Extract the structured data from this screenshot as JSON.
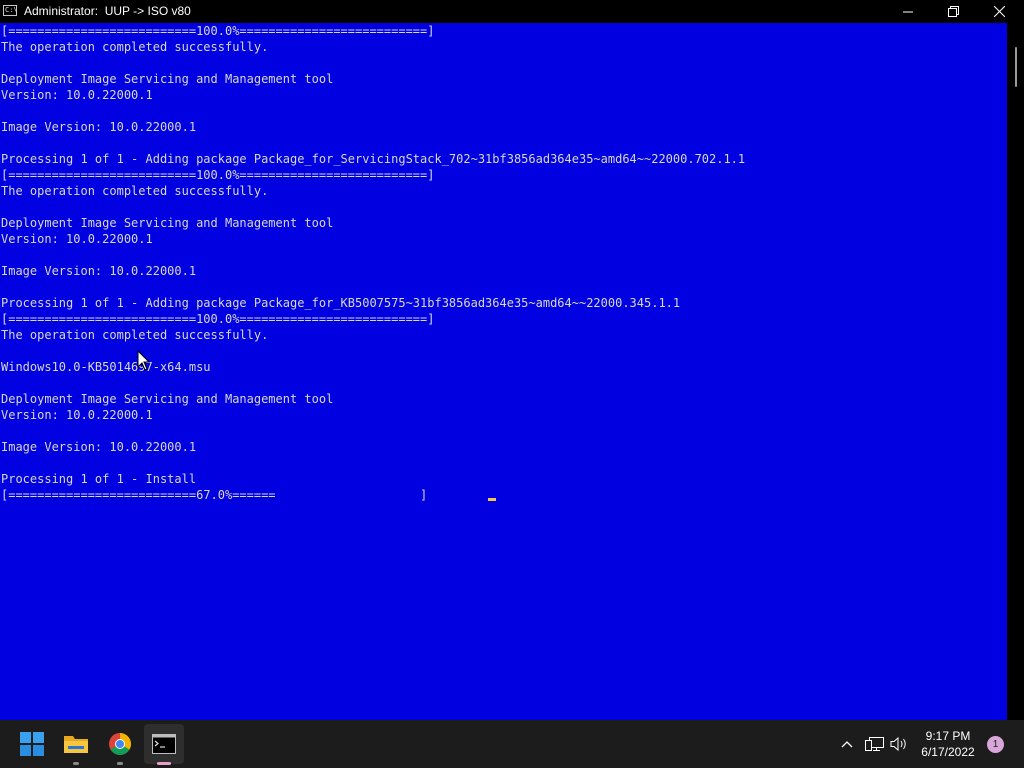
{
  "window": {
    "title": "Administrator:  UUP -> ISO v80",
    "icon_text": "C:\\"
  },
  "console": {
    "lines": [
      "[==========================100.0%==========================]",
      "The operation completed successfully.",
      "",
      "Deployment Image Servicing and Management tool",
      "Version: 10.0.22000.1",
      "",
      "Image Version: 10.0.22000.1",
      "",
      "Processing 1 of 1 - Adding package Package_for_ServicingStack_702~31bf3856ad364e35~amd64~~22000.702.1.1",
      "[==========================100.0%==========================]",
      "The operation completed successfully.",
      "",
      "Deployment Image Servicing and Management tool",
      "Version: 10.0.22000.1",
      "",
      "Image Version: 10.0.22000.1",
      "",
      "Processing 1 of 1 - Adding package Package_for_KB5007575~31bf3856ad364e35~amd64~~22000.345.1.1",
      "[==========================100.0%==========================]",
      "The operation completed successfully.",
      "",
      "Windows10.0-KB5014697-x64.msu",
      "",
      "Deployment Image Servicing and Management tool",
      "Version: 10.0.22000.1",
      "",
      "Image Version: 10.0.22000.1",
      "",
      "Processing 1 of 1 - Install",
      "[==========================67.0%======                    ]"
    ],
    "background": "#0000e0",
    "foreground": "#d8d8d8",
    "progress_percent": 67.0
  },
  "taskbar": {
    "apps": [
      {
        "icon": "windows-start-icon"
      },
      {
        "icon": "file-explorer-icon"
      },
      {
        "icon": "chrome-icon"
      },
      {
        "icon": "command-prompt-icon"
      }
    ],
    "tray": {
      "icons": [
        "chevron-up-icon",
        "network-icon",
        "volume-icon"
      ],
      "time": "9:17 PM",
      "date": "6/17/2022",
      "notification_count": "1"
    }
  }
}
